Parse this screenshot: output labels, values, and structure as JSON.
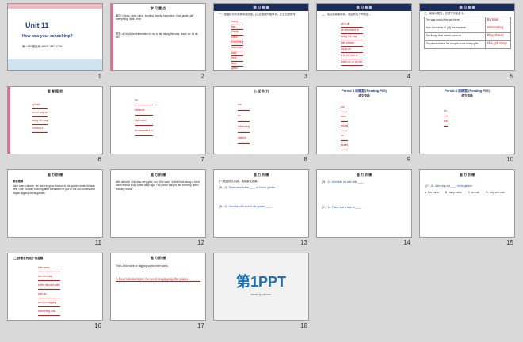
{
  "slides": [
    {
      "num": "1",
      "title": "Unit 11",
      "subtitle": "How was your school trip?",
      "footer": "第一PPT模板网-WWW.1PPT.COM"
    },
    {
      "num": "2",
      "header": "学 习 重 点",
      "text1": "单词: cheap, slow, robot, exciting, lovely, expensive, fast, guide, gift, everything, dark, hear",
      "text2": "短语: all in all, be interested in, not at all, along the way, teach sb. to do sth."
    },
    {
      "num": "3",
      "header": "预 习 检 测",
      "intro": "一、根据提示写出单词或短语。(注意根据所给单词，在空白处填写)",
      "answers": [
        "lovely",
        "fast",
        "cheap",
        "robot",
        "everything",
        "interested",
        "dark",
        "hear",
        "slow",
        "guide",
        "fast"
      ]
    },
    {
      "num": "4",
      "header": "预 习 检 测",
      "intro": "二、请认真阅读课本，然后完成下列短语。",
      "answers": [
        "all in all",
        "be interested in",
        "along the way",
        "take photos",
        "not at all",
        "a lot of / lots of",
        "teach sb. to do sth."
      ]
    },
    {
      "num": "5",
      "header": "预 习 检 测",
      "intro": "三、阅读2b短文，完成下列信息卡。",
      "rows": [
        {
          "q": "The way (how) they got there",
          "a": "By train"
        },
        {
          "q": "How Jim thinks of (对) the museum",
          "a": "Interesting"
        },
        {
          "q": "The things that robots could do",
          "a": "Play chess"
        },
        {
          "q": "The place where Jim bought some lovely gifts",
          "a": "The gift shop"
        }
      ]
    },
    {
      "num": "6",
      "header": "思 考 探 究",
      "answers": [
        "by train",
        "on the way to",
        "along the way",
        "in front of"
      ]
    },
    {
      "num": "7",
      "answers": [
        "so",
        "because",
        "interested",
        "be interested in"
      ]
    },
    {
      "num": "8",
      "header": "小 试 牛 刀",
      "answers": [
        "but",
        "so",
        "interesting",
        "interest"
      ]
    },
    {
      "num": "9",
      "header": "Period 3 训练案 (Reading P65)",
      "subheader": "成文巡检",
      "answers": [
        "but",
        "slow",
        "robots",
        "lot",
        "taught"
      ]
    },
    {
      "num": "10",
      "header": "Period 3 训练案 (Reading P65)",
      "subheader": "成文巡检",
      "answers": [
        "for",
        "but"
      ]
    },
    {
      "num": "11",
      "header": "能 力 阶 梯",
      "heading": "阅读理解",
      "text": "John was a farmer. He liked to grow flowers in his garden when he was free. One Sunday morning after breakfast he put on his old clothes and began digging in his garden."
    },
    {
      "num": "12",
      "header": "能 力 阶 梯",
      "text": "wife about it. She was very glad, too. She said, \"A thief took away a lot of coins from a shop a few days ago. The police caught him but they didn't find any coins.\""
    },
    {
      "num": "13",
      "header": "能 力 阶 梯",
      "intro": "(一)根据短文内容，选择最佳答案。",
      "q1": "( B ) 11. There were some ____ in John's garden.",
      "q2": "( B ) 12. John found a coin in his garden ____."
    },
    {
      "num": "14",
      "header": "能 力 阶 梯",
      "q1": "( B ) 13. John told his wife that ____.",
      "q2": "( C ) 14. There was a hole in ____."
    },
    {
      "num": "15",
      "header": "能 力 阶 梯",
      "q1": "( D ) 15. John dug out ____ in his garden.",
      "opts": [
        "A. five coins",
        "B. many coins",
        "C. no coin",
        "D. only one coin"
      ]
    },
    {
      "num": "16",
      "header": "(二)按要求完成下列各题",
      "answers": [
        "take away",
        "the next day",
        "a few minutes later",
        "pick up",
        "went on digging",
        "something cold"
      ]
    },
    {
      "num": "17",
      "header": "能 力 阶 梯",
      "text": "Then John went on digging some more coins.",
      "answer": "A few minutes later, he went on playing the piano."
    },
    {
      "num": "18",
      "logo": "第1PPT",
      "logo_sub": "www.1ppt.com"
    }
  ]
}
